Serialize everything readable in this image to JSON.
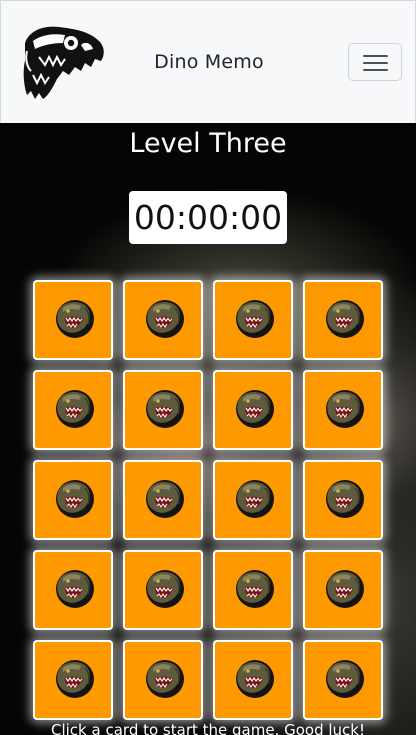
{
  "navbar": {
    "brand": "Dino Memo",
    "logo_icon": "trex-skull-icon",
    "menu_icon": "hamburger-menu-icon"
  },
  "game": {
    "level_title": "Level Three",
    "timer": "00:00:00",
    "card_icon": "trex-head-card-back-icon",
    "card_color": "#ff9900",
    "rows": 5,
    "columns": 4,
    "hint": "Click a card to start the game. Good luck!"
  }
}
